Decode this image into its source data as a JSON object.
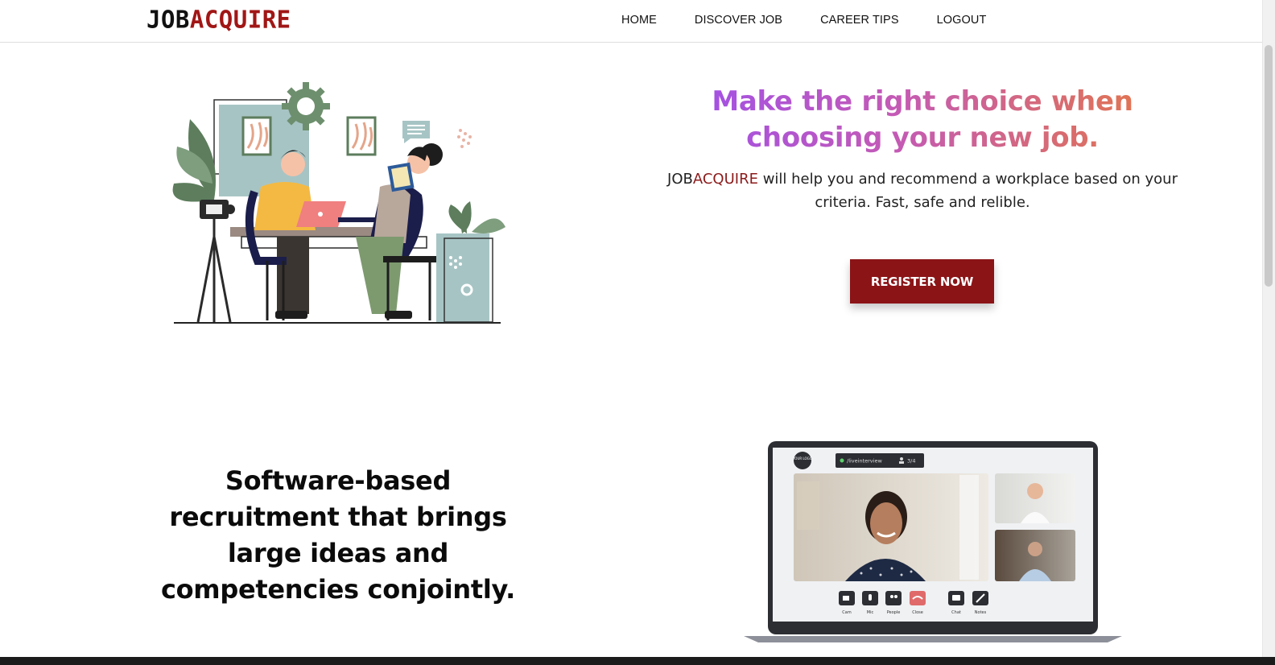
{
  "header": {
    "logo_part1": "JOB",
    "logo_part2": "ACQUIRE",
    "nav": [
      {
        "label": "HOME"
      },
      {
        "label": "DISCOVER JOB"
      },
      {
        "label": "CAREER TIPS"
      },
      {
        "label": "LOGOUT"
      }
    ]
  },
  "hero": {
    "headline": "Make the right choice when choosing your new job.",
    "lead_brand_part1": "JOB",
    "lead_brand_part2": "ACQUIRE",
    "lead_text": " will help you and recommend a workplace based on your criteria. Fast, safe and relible.",
    "cta_label": "REGISTER NOW",
    "illustration_icon": "interview-illustration"
  },
  "section2": {
    "heading": "Software-based recruitment that brings large ideas and competencies conjointly.",
    "laptop": {
      "url_text": "/liveinterview",
      "participants": "3/4",
      "avatar_text": "YOUR LOGO",
      "controls": [
        {
          "label": "Cam",
          "icon": "camera-icon"
        },
        {
          "label": "Mic",
          "icon": "mic-icon"
        },
        {
          "label": "People",
          "icon": "people-icon"
        },
        {
          "label": "Close",
          "icon": "hangup-icon"
        },
        {
          "label": "Chat",
          "icon": "chat-icon"
        },
        {
          "label": "Notes",
          "icon": "pencil-icon"
        }
      ]
    }
  },
  "colors": {
    "brand_red": "#8b1417",
    "gradient_start": "#9b4ff0",
    "gradient_end": "#e77a3c"
  }
}
